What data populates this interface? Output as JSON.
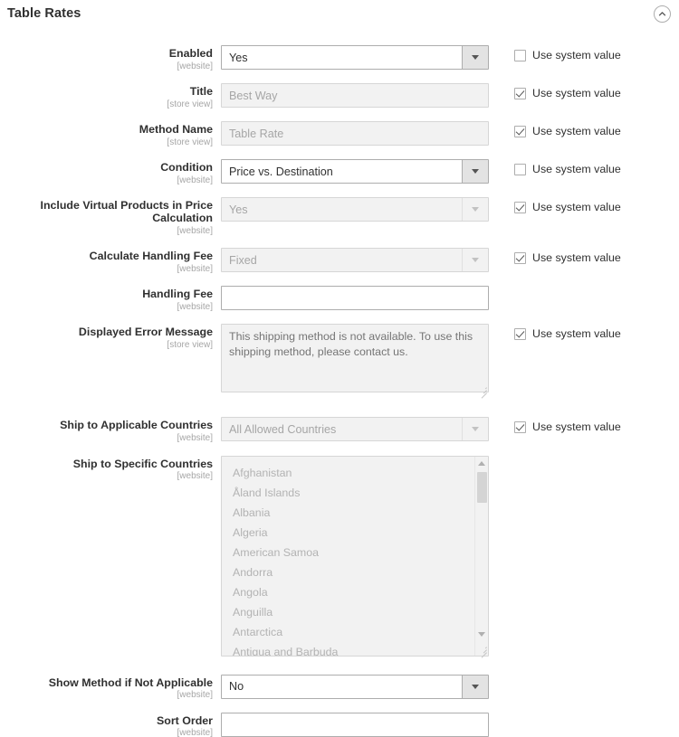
{
  "section": {
    "title": "Table Rates",
    "collapse_icon": "chevron-up-circle-icon"
  },
  "common": {
    "use_system_value": "Use system value",
    "scope_website": "[website]",
    "scope_store_view": "[store view]"
  },
  "fields": [
    {
      "key": "enabled",
      "label": "Enabled",
      "scope": "[website]",
      "control": "select",
      "value": "Yes",
      "disabled": false,
      "use_system_value": false,
      "has_checkbox": true
    },
    {
      "key": "title",
      "label": "Title",
      "scope": "[store view]",
      "control": "text",
      "value": "Best Way",
      "disabled": true,
      "use_system_value": true,
      "has_checkbox": true
    },
    {
      "key": "method_name",
      "label": "Method Name",
      "scope": "[store view]",
      "control": "text",
      "value": "Table Rate",
      "disabled": true,
      "use_system_value": true,
      "has_checkbox": true
    },
    {
      "key": "condition",
      "label": "Condition",
      "scope": "[website]",
      "control": "select",
      "value": "Price vs. Destination",
      "disabled": false,
      "use_system_value": false,
      "has_checkbox": true
    },
    {
      "key": "include_virtual_products",
      "label": "Include Virtual Products in Price Calculation",
      "scope": "[website]",
      "control": "select",
      "value": "Yes",
      "disabled": true,
      "use_system_value": true,
      "has_checkbox": true
    },
    {
      "key": "calculate_handling_fee",
      "label": "Calculate Handling Fee",
      "scope": "[website]",
      "control": "select",
      "value": "Fixed",
      "disabled": true,
      "use_system_value": true,
      "has_checkbox": true
    },
    {
      "key": "handling_fee",
      "label": "Handling Fee",
      "scope": "[website]",
      "control": "text",
      "value": "",
      "disabled": false,
      "use_system_value": false,
      "has_checkbox": false
    },
    {
      "key": "displayed_error_message",
      "label": "Displayed Error Message",
      "scope": "[store view]",
      "control": "textarea",
      "value": "This shipping method is not available. To use this shipping method, please contact us.",
      "disabled": true,
      "use_system_value": true,
      "has_checkbox": true
    },
    {
      "key": "ship_to_applicable_countries",
      "label": "Ship to Applicable Countries",
      "scope": "[website]",
      "control": "select",
      "value": "All Allowed Countries",
      "disabled": true,
      "use_system_value": true,
      "has_checkbox": true
    },
    {
      "key": "ship_to_specific_countries",
      "label": "Ship to Specific Countries",
      "scope": "[website]",
      "control": "multiselect",
      "options": [
        "Afghanistan",
        "Åland Islands",
        "Albania",
        "Algeria",
        "American Samoa",
        "Andorra",
        "Angola",
        "Anguilla",
        "Antarctica",
        "Antigua and Barbuda"
      ],
      "disabled": true,
      "use_system_value": false,
      "has_checkbox": false
    },
    {
      "key": "show_method_if_not_applicable",
      "label": "Show Method if Not Applicable",
      "scope": "[website]",
      "control": "select",
      "value": "No",
      "disabled": false,
      "use_system_value": false,
      "has_checkbox": false
    },
    {
      "key": "sort_order",
      "label": "Sort Order",
      "scope": "[website]",
      "control": "text",
      "value": "",
      "disabled": false,
      "use_system_value": false,
      "has_checkbox": false
    }
  ],
  "colors": {
    "text": "#303030",
    "muted": "#a6a6a6",
    "border": "#adadad",
    "disabled_bg": "#f2f2f2",
    "select_button_bg": "#e3e3e3"
  }
}
